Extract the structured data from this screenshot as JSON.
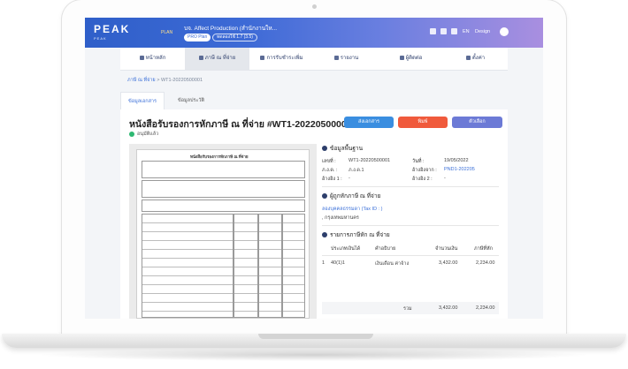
{
  "topbar": {
    "logo": "PEAK",
    "logo_sub": "PEAK",
    "plan": "PLAN",
    "company": "บจ. Affect Production (สำนักงานให...",
    "pill_primary": "PRO Plan",
    "pill_secondary": "ทดลองใช้ 1.7 (3.5)",
    "lang": "EN",
    "user": "Design"
  },
  "nav": {
    "items": [
      {
        "label": "หน้าหลัก",
        "icon": "home-icon"
      },
      {
        "label": "ภาษี ณ ที่จ่าย",
        "icon": "tax-icon"
      },
      {
        "label": "การรับชำระเพิ่ม",
        "icon": "receive-icon"
      },
      {
        "label": "รายงาน",
        "icon": "report-icon"
      },
      {
        "label": "ผู้ติดต่อ",
        "icon": "contact-icon"
      },
      {
        "label": "ตั้งค่า",
        "icon": "gear-icon"
      }
    ]
  },
  "breadcrumb": {
    "parent": "ภาษี ณ ที่จ่าย",
    "sep": ">",
    "current": "WT1-20220500001"
  },
  "tabs": {
    "primary": "ข้อมูลเอกสาร",
    "secondary": "ข้อมูลประวัติ"
  },
  "document": {
    "title": "หนังสือรับรองการหักภาษี ณ ที่จ่าย #WT1-20220500001",
    "status": "อนุมัติแล้ว",
    "btn_send": "ส่งเอกสาร",
    "btn_print": "พิมพ์",
    "btn_more": "ตัวเลือก"
  },
  "preview": {
    "heading": "หนังสือรับรองการหักภาษี ณ ที่จ่าย"
  },
  "basic_info": {
    "heading": "ข้อมูลพื้นฐาน",
    "doc_no_label": "เลขที่ :",
    "doc_no": "WT1-20220500001",
    "date_label": "วันที่ :",
    "date": "19/05/2022",
    "form_label": "ภ.ง.ด. :",
    "form": "ภ.ง.ด.1",
    "ref_label": "อ้างอิงจาก :",
    "ref": "PND1-202205",
    "ref1_label": "อ้างอิง 1 :",
    "ref1": "-",
    "ref2_label": "อ้างอิง 2 :",
    "ref2": "-"
  },
  "payer": {
    "heading": "ผู้ถูกหักภาษี ณ ที่จ่าย",
    "name": "ลองบุคคลธรรมดา (Tax ID : )",
    "address": ", กรุงเทพมหานคร"
  },
  "items": {
    "heading": "รายการภาษีหัก ณ ที่จ่าย",
    "columns": [
      "ประเภทเงินได้",
      "คำอธิบาย",
      "จำนวนเงิน",
      "ภาษีที่หัก"
    ],
    "rows": [
      {
        "no": "1",
        "type": "40(1)1",
        "desc": "เงินเดือน ค่าจ้าง",
        "amount": "3,432.00",
        "tax": "2,234.00"
      }
    ],
    "total_label": "รวม",
    "total_amount": "3,432.00",
    "total_tax": "2,234.00"
  }
}
